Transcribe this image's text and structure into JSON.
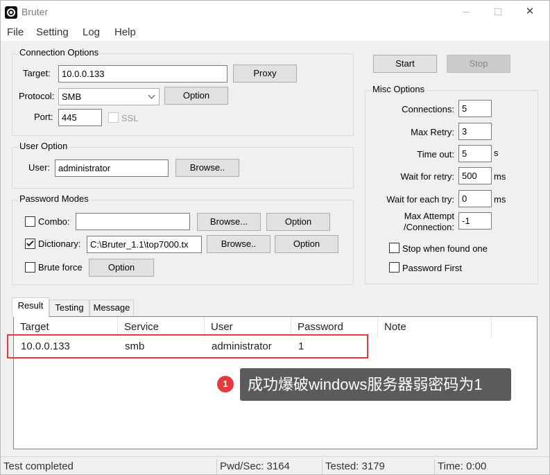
{
  "window": {
    "title": "Bruter",
    "close_glyph": "✕"
  },
  "menu": {
    "items": [
      "File",
      "Setting",
      "Log",
      "Help"
    ]
  },
  "connection": {
    "title": "Connection Options",
    "target_label": "Target:",
    "target_value": "10.0.0.133",
    "proxy_label": "Proxy",
    "protocol_label": "Protocol:",
    "protocol_value": "SMB",
    "option_label": "Option",
    "port_label": "Port:",
    "port_value": "445",
    "ssl_label": "SSL"
  },
  "user_option": {
    "title": "User Option",
    "user_label": "User:",
    "user_value": "administrator",
    "browse_label": "Browse.."
  },
  "password_modes": {
    "title": "Password Modes",
    "combo_label": "Combo:",
    "combo_value": "",
    "combo_browse": "Browse...",
    "combo_option": "Option",
    "dict_label": "Dictionary:",
    "dict_value": "C:\\Bruter_1.1\\top7000.tx",
    "dict_checked": true,
    "dict_browse": "Browse..",
    "dict_option": "Option",
    "brute_label": "Brute force",
    "brute_option": "Option"
  },
  "actions": {
    "start": "Start",
    "stop": "Stop"
  },
  "misc": {
    "title": "Misc Options",
    "connections_label": "Connections:",
    "connections_value": "5",
    "max_retry_label": "Max Retry:",
    "max_retry_value": "3",
    "timeout_label": "Time out:",
    "timeout_value": "5",
    "timeout_unit": "s",
    "wait_retry_label": "Wait for retry:",
    "wait_retry_value": "500",
    "wait_retry_unit": "ms",
    "wait_try_label": "Wait for each try:",
    "wait_try_value": "0",
    "wait_try_unit": "ms",
    "max_attempt_label_1": "Max Attempt",
    "max_attempt_label_2": "/Connection:",
    "max_attempt_value": "-1",
    "stop_found_label": "Stop when found one",
    "password_first_label": "Password First"
  },
  "tabs": [
    "Result",
    "Testing",
    "Message"
  ],
  "results": {
    "columns": [
      "Target",
      "Service",
      "User",
      "Password",
      "Note"
    ],
    "rows": [
      {
        "target": "10.0.0.133",
        "service": "smb",
        "user": "administrator",
        "password": "1",
        "note": ""
      }
    ]
  },
  "annotation": {
    "badge": "1",
    "text": "成功爆破windows服务器弱密码为1",
    "color": "#e23c3c"
  },
  "status": {
    "state": "Test completed",
    "pwd_sec": "Pwd/Sec: 3164",
    "tested": "Tested: 3179",
    "time": "Time: 0:00"
  }
}
